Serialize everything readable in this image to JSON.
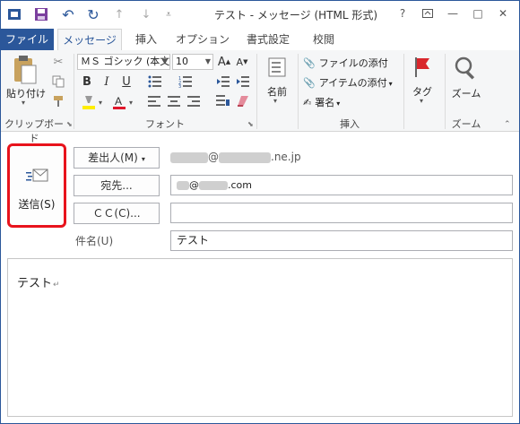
{
  "window": {
    "title": "テスト - メッセージ (HTML 形式)",
    "help": "?",
    "restore": "▢",
    "minimize": "—",
    "maximize": "□",
    "close": "✕"
  },
  "tabs": [
    "ファイル",
    "メッセージ",
    "挿入",
    "オプション",
    "書式設定",
    "校閲"
  ],
  "ribbon": {
    "clipboard": {
      "paste": "貼り付け",
      "label": "クリップボード"
    },
    "font": {
      "font_name": "ＭＳ ゴシック (本文",
      "font_size": "10",
      "grow": "A",
      "shrink": "A",
      "bold": "B",
      "italic": "I",
      "underline": "U",
      "label": "フォント"
    },
    "names": {
      "label": "名前"
    },
    "insert": {
      "attach_file": "ファイルの添付",
      "attach_item": "アイテムの添付",
      "signature": "署名",
      "label": "挿入"
    },
    "tags": {
      "label": "タグ"
    },
    "zoom": {
      "button": "ズーム",
      "label": "ズーム"
    }
  },
  "compose": {
    "send": "送信(S)",
    "from_button": "差出人(M)",
    "from_value": "@",
    "from_domain": ".ne.jp",
    "to_button": "宛先...",
    "to_value_at": "@",
    "to_value_domain": ".com",
    "cc_button": "ＣＣ(C)...",
    "cc_value": "",
    "subject_label": "件名(U)",
    "subject_value": "テスト",
    "body": "テスト",
    "body_mark": "↵"
  },
  "colors": {
    "accent": "#2b579a",
    "highlight_box": "#e8131c",
    "highlight_yellow": "#ffee00",
    "font_red": "#e0162b"
  }
}
